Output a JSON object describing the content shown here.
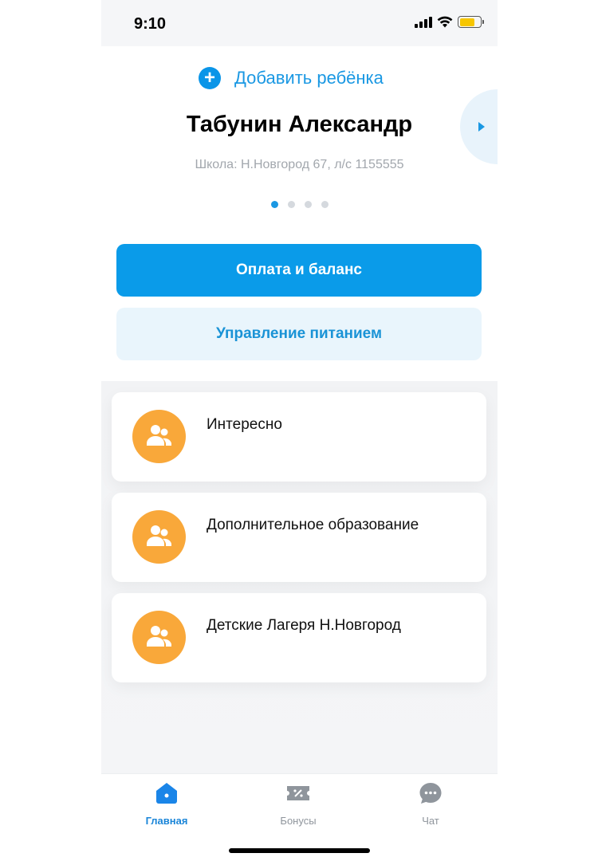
{
  "status_bar": {
    "time": "9:10"
  },
  "header": {
    "add_child_label": "Добавить ребёнка",
    "child_name": "Табунин Александр",
    "school_info": "Школа: Н.Новгород 67, л/с 1155555",
    "pager": {
      "count": 4,
      "active_index": 0
    }
  },
  "actions": {
    "payment_label": "Оплата и баланс",
    "food_label": "Управление питанием"
  },
  "feed": {
    "items": [
      {
        "title": "Интересно",
        "icon": "group-icon"
      },
      {
        "title": "Дополнительное образование",
        "icon": "group-icon"
      },
      {
        "title": "Детские Лагеря Н.Новгород",
        "icon": "group-icon"
      }
    ]
  },
  "tab_bar": {
    "tabs": [
      {
        "label": "Главная",
        "icon": "home-icon",
        "active": true
      },
      {
        "label": "Бонусы",
        "icon": "ticket-icon",
        "active": false
      },
      {
        "label": "Чат",
        "icon": "chat-icon",
        "active": false
      }
    ]
  },
  "colors": {
    "accent": "#0a9be9",
    "accent_light": "#e9f5fc",
    "card_icon": "#f9a83a",
    "tab_inactive": "#8f959c"
  }
}
